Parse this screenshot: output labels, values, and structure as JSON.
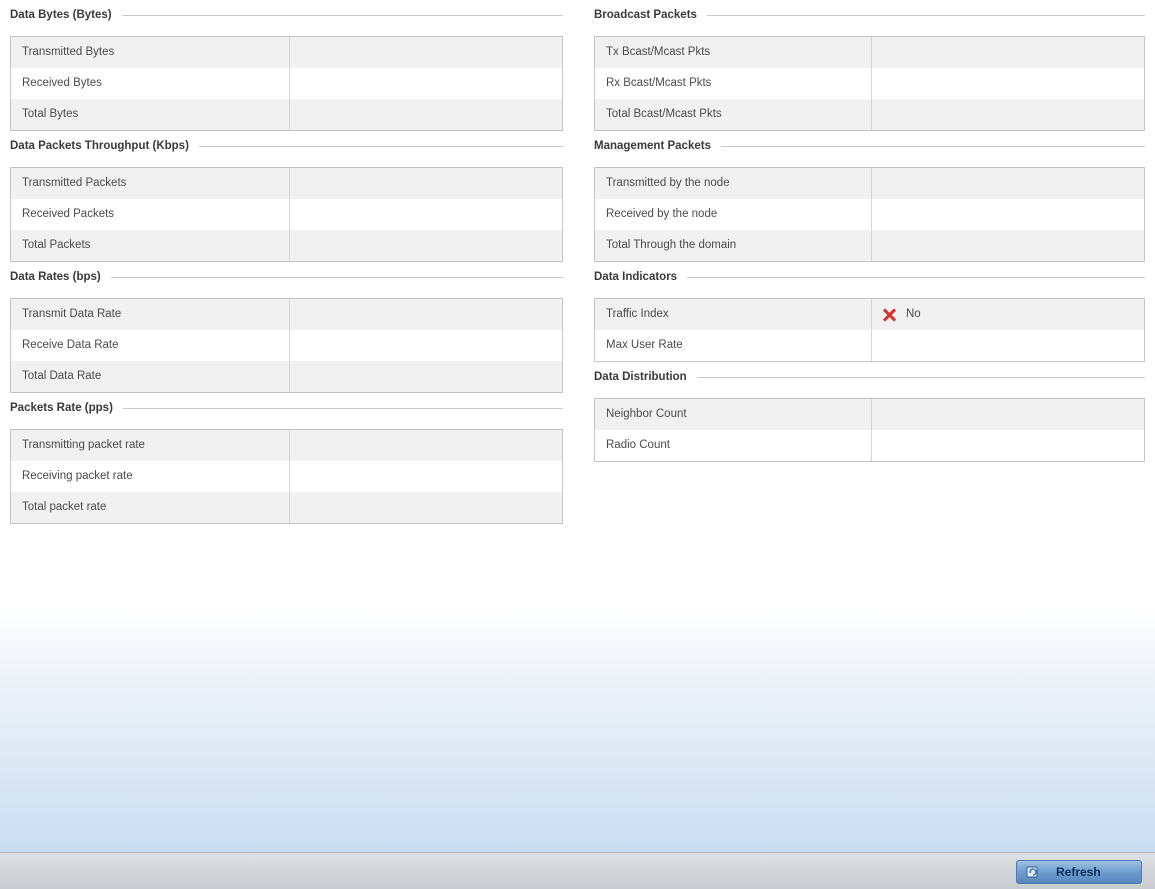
{
  "left_sections": [
    {
      "title": "Data Bytes (Bytes)",
      "rows": [
        {
          "label": "Transmitted Bytes",
          "value": ""
        },
        {
          "label": "Received Bytes",
          "value": ""
        },
        {
          "label": "Total Bytes",
          "value": ""
        }
      ]
    },
    {
      "title": "Data Packets Throughput (Kbps)",
      "rows": [
        {
          "label": "Transmitted Packets",
          "value": ""
        },
        {
          "label": "Received Packets",
          "value": ""
        },
        {
          "label": "Total Packets",
          "value": ""
        }
      ]
    },
    {
      "title": "Data Rates (bps)",
      "rows": [
        {
          "label": "Transmit Data Rate",
          "value": ""
        },
        {
          "label": "Receive Data Rate",
          "value": ""
        },
        {
          "label": "Total Data Rate",
          "value": ""
        }
      ]
    },
    {
      "title": "Packets Rate (pps)",
      "rows": [
        {
          "label": "Transmitting packet rate",
          "value": ""
        },
        {
          "label": "Receiving packet rate",
          "value": ""
        },
        {
          "label": "Total packet rate",
          "value": ""
        }
      ]
    }
  ],
  "right_sections": [
    {
      "title": "Broadcast Packets",
      "rows": [
        {
          "label": "Tx Bcast/Mcast Pkts",
          "value": ""
        },
        {
          "label": "Rx Bcast/Mcast Pkts",
          "value": ""
        },
        {
          "label": "Total Bcast/Mcast Pkts",
          "value": ""
        }
      ]
    },
    {
      "title": "Management Packets",
      "rows": [
        {
          "label": "Transmitted by the node",
          "value": ""
        },
        {
          "label": "Received by the node",
          "value": ""
        },
        {
          "label": "Total Through the domain",
          "value": ""
        }
      ]
    },
    {
      "title": "Data Indicators",
      "rows": [
        {
          "label": "Traffic Index",
          "value": "No",
          "icon": "x-mark-icon",
          "icon_color": "#d9312b"
        },
        {
          "label": "Max User Rate",
          "value": ""
        }
      ]
    },
    {
      "title": "Data Distribution",
      "rows": [
        {
          "label": "Neighbor Count",
          "value": ""
        },
        {
          "label": "Radio Count",
          "value": ""
        }
      ]
    }
  ],
  "footer": {
    "refresh_label": "Refresh",
    "refresh_icon": "refresh-icon"
  },
  "colors": {
    "accent_button": "#6b9acc",
    "status_error": "#d9312b"
  }
}
